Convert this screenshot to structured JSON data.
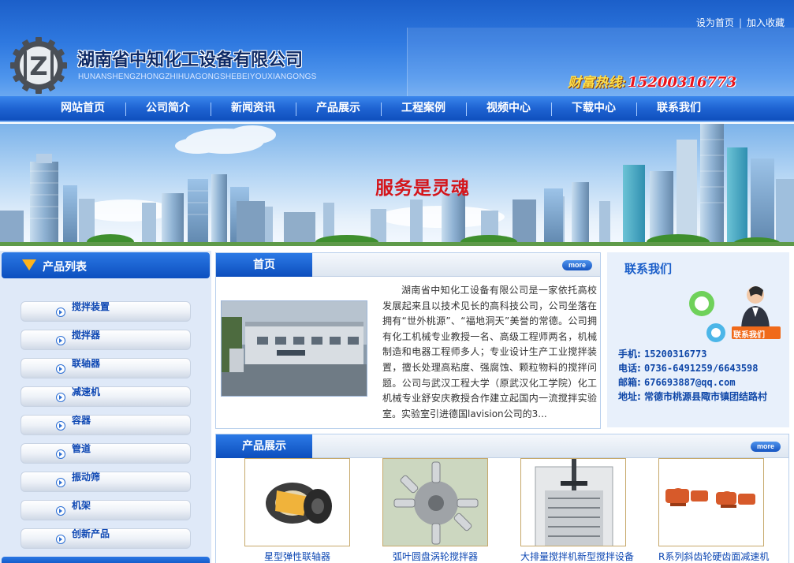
{
  "header": {
    "company_name": "湖南省中知化工设备有限公司",
    "company_pinyin": "HUNANSHENGZHONGZHIHUAGONGSHEBEIYOUXIANGONGS",
    "hotline_label": "财富热线:",
    "hotline_number": "15200316773",
    "links": [
      "设为首页",
      "加入收藏"
    ]
  },
  "nav": {
    "items": [
      "网站首页",
      "公司简介",
      "新闻资讯",
      "产品展示",
      "工程案例",
      "视频中心",
      "下载中心",
      "联系我们"
    ]
  },
  "banner": {
    "slogan": "服务是灵魂"
  },
  "sidebar": {
    "title": "产品列表",
    "items": [
      "搅拌装置",
      "搅拌器",
      "联轴器",
      "减速机",
      "容器",
      "管道",
      "振动筛",
      "机架",
      "创新产品"
    ]
  },
  "intro": {
    "tab": "首页",
    "more": "more",
    "text": "湖南省中知化工设备有限公司是一家依托高校发展起来且以技术见长的高科技公司，公司坐落在拥有“世外桃源”、“福地洞天”美誉的常德。公司拥有化工机械专业教授一名、高级工程师两名，机械制造和电器工程师多人；专业设计生产工业搅拌装置，擅长处理高粘度、强腐蚀、颗粒物料的搅拌问题。公司与武汉工程大学（原武汉化工学院）化工机械专业舒安庆教授合作建立起国内一流搅拌实验室。实验室引进德国lavision公司的3..."
  },
  "contact": {
    "title": "联系我们",
    "badge": "联系我们",
    "mobile_label": "手机:",
    "mobile": "15200316773",
    "phone_label": "电话:",
    "phone": "0736-6491259/6643598",
    "email_label": "邮箱:",
    "email": "676693887@qq.com",
    "address_label": "地址:",
    "address": "常德市桃源县陬市镇团结路村"
  },
  "products": {
    "tab": "产品展示",
    "more": "more",
    "items": [
      {
        "caption": "星型弹性联轴器",
        "icon": "coupling-image"
      },
      {
        "caption": "弧叶圆盘涡轮搅拌器",
        "icon": "turbine-image"
      },
      {
        "caption": "大排量搅拌机新型搅拌设备",
        "icon": "tank-image"
      },
      {
        "caption": "R系列斜齿轮硬齿面减速机",
        "icon": "reducer-image"
      }
    ]
  },
  "colors": {
    "nav_blue": "#1e63d2",
    "link_blue": "#0d47b3",
    "hotline_red": "#e8141c",
    "hotline_yellow": "#ffe04a",
    "slogan_red": "#d4151b"
  }
}
